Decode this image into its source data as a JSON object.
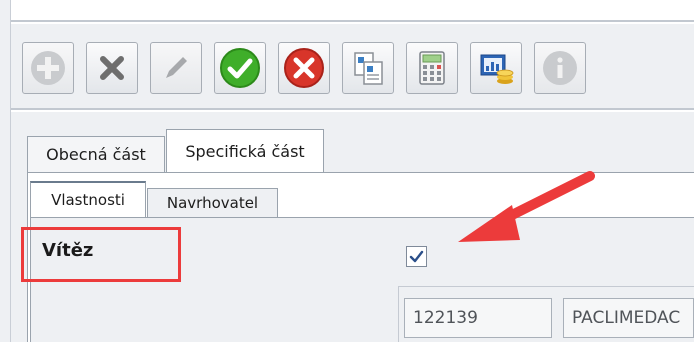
{
  "toolbar": {
    "buttons": [
      {
        "icon": "add-icon",
        "enabled": false
      },
      {
        "icon": "delete-icon",
        "enabled": true
      },
      {
        "icon": "edit-icon",
        "enabled": false
      },
      {
        "icon": "confirm-icon",
        "enabled": true
      },
      {
        "icon": "cancel-icon",
        "enabled": true
      },
      {
        "icon": "copy-document-icon",
        "enabled": true
      },
      {
        "icon": "calculator-icon",
        "enabled": true
      },
      {
        "icon": "report-coins-icon",
        "enabled": true
      },
      {
        "icon": "info-icon",
        "enabled": false
      }
    ]
  },
  "tabs": [
    {
      "label": "Obecná část",
      "active": false
    },
    {
      "label": "Specifická část",
      "active": true
    }
  ],
  "subtabs": [
    {
      "label": "Vlastnosti",
      "active": true
    },
    {
      "label": "Navrhovatel",
      "active": false
    }
  ],
  "properties": {
    "winner_label": "Vítěz",
    "winner_checked": true,
    "code_value": "122139",
    "name_value": "PACLIMEDAC"
  },
  "colors": {
    "highlight": "#ec3b3b",
    "arrow": "#ec3b3b",
    "confirm_green": "#3fae2a",
    "cancel_red": "#d8352a"
  }
}
